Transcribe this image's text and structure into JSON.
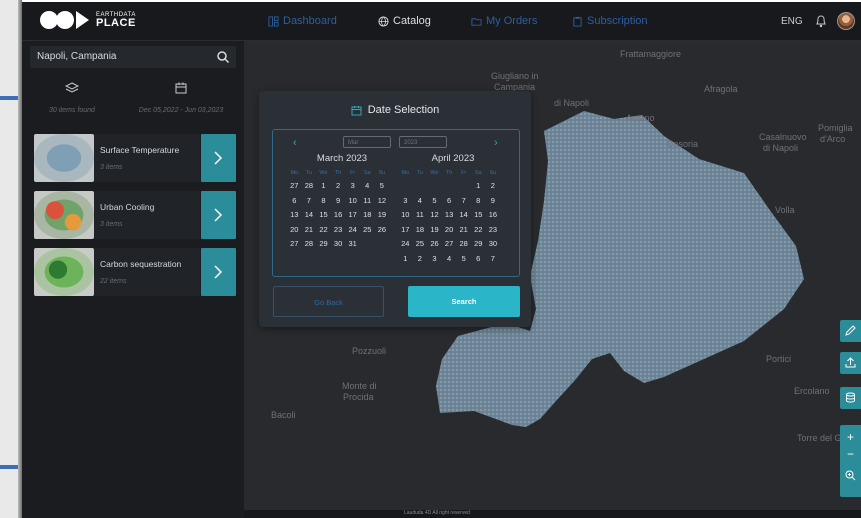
{
  "brand": {
    "line1": "EARTHDATA",
    "line2": "PLACE"
  },
  "nav": {
    "items": [
      {
        "label": "Dashboard",
        "icon": "dashboard-icon"
      },
      {
        "label": "Catalog",
        "icon": "globe-icon"
      },
      {
        "label": "My Orders",
        "icon": "folder-icon"
      },
      {
        "label": "Subscription",
        "icon": "clipboard-icon"
      }
    ],
    "language": "ENG"
  },
  "sidebar": {
    "search_value": "Napoli, Campania",
    "items_found": "30 items found",
    "date_range": "Dec 05,2022 - Jun 03,2023",
    "cards": [
      {
        "title": "Surface Temperature",
        "count": "3 items"
      },
      {
        "title": "Urban Cooling",
        "count": "3 items"
      },
      {
        "title": "Carbon sequestration",
        "count": "22 items"
      }
    ]
  },
  "map": {
    "places": [
      "Frattamaggiore",
      "Giugliano in",
      "Campania",
      "Afragola",
      "di Napoli",
      "Arzano",
      "Casoria",
      "Casalnuovo",
      "di Napoli",
      "Pomiglia",
      "d'Arco",
      "Volla",
      "Pozzuoli",
      "Monte di",
      "Procida",
      "Bacoli",
      "Portici",
      "Ercolano",
      "Torre del Greco"
    ],
    "footer": "Laududa 4D All right reserved"
  },
  "modal": {
    "title": "Date Selection",
    "month_placeholder": "Mar",
    "year_placeholder": "2023",
    "weekdays": [
      "Mo",
      "Tu",
      "We",
      "Th",
      "Fr",
      "Sa",
      "Su"
    ],
    "months": [
      {
        "name": "March 2023",
        "days": [
          "27",
          "28",
          "1",
          "2",
          "3",
          "4",
          "5",
          "6",
          "7",
          "8",
          "9",
          "10",
          "11",
          "12",
          "13",
          "14",
          "15",
          "16",
          "17",
          "18",
          "19",
          "20",
          "21",
          "22",
          "23",
          "24",
          "25",
          "26",
          "27",
          "28",
          "29",
          "30",
          "31"
        ]
      },
      {
        "name": "April 2023",
        "days": [
          "",
          "",
          "",
          "",
          "",
          "1",
          "2",
          "3",
          "4",
          "5",
          "6",
          "7",
          "8",
          "9",
          "10",
          "11",
          "12",
          "13",
          "14",
          "15",
          "16",
          "17",
          "18",
          "19",
          "20",
          "21",
          "22",
          "23",
          "24",
          "25",
          "26",
          "27",
          "28",
          "29",
          "30",
          "1",
          "2",
          "3",
          "4",
          "5",
          "6",
          "7"
        ]
      }
    ],
    "back_label": "Go Back",
    "search_label": "Search"
  }
}
